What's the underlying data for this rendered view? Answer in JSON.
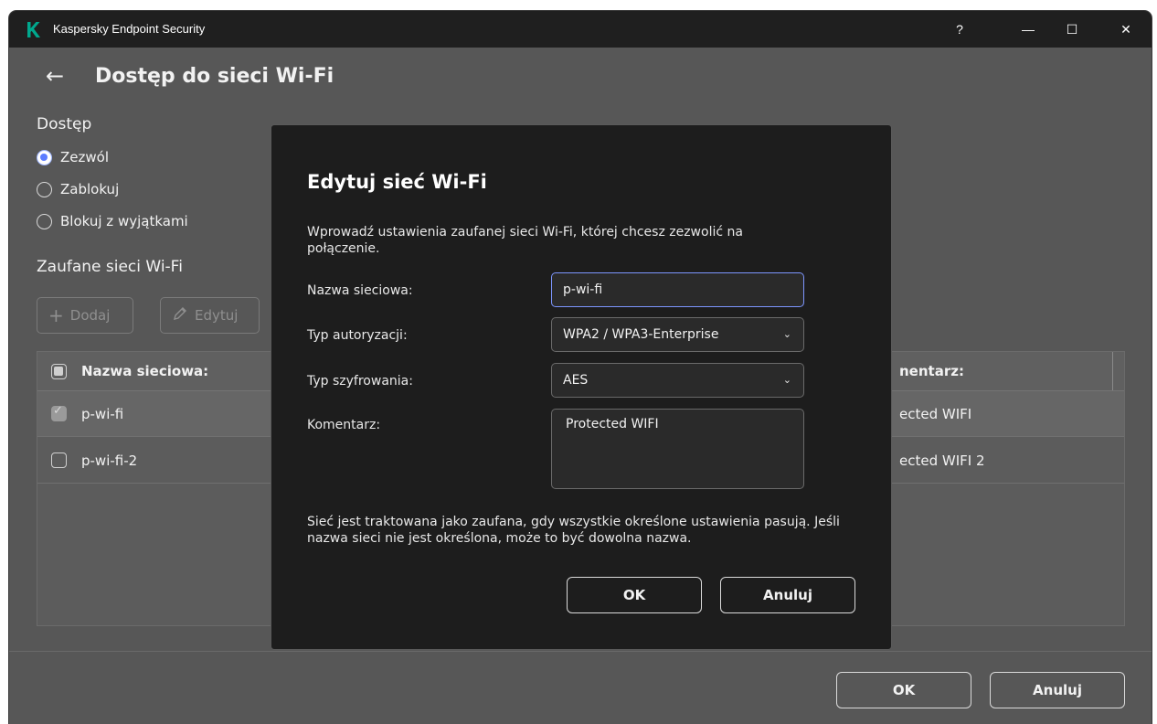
{
  "window": {
    "title": "Kaspersky Endpoint Security",
    "help_label": "?",
    "minimize_label": "—",
    "maximize_label": "☐",
    "close_label": "✕"
  },
  "page": {
    "back_label": "←",
    "title": "Dostęp do sieci Wi-Fi"
  },
  "access": {
    "heading": "Dostęp",
    "options": [
      {
        "label": "Zezwól",
        "selected": true
      },
      {
        "label": "Zablokuj",
        "selected": false
      },
      {
        "label": "Blokuj z wyjątkami",
        "selected": false
      }
    ]
  },
  "trusted": {
    "heading": "Zaufane sieci Wi-Fi",
    "add_label": "Dodaj",
    "edit_label": "Edytuj",
    "columns": {
      "name": "Nazwa sieciowa:",
      "comment": "nentarz:"
    },
    "rows": [
      {
        "name": "p-wi-fi",
        "comment": "ected WIFI",
        "checked": true
      },
      {
        "name": "p-wi-fi-2",
        "comment": "ected WIFI 2",
        "checked": false
      }
    ]
  },
  "footer": {
    "ok_label": "OK",
    "cancel_label": "Anuluj"
  },
  "dialog": {
    "title": "Edytuj sieć Wi-Fi",
    "description": "Wprowadź ustawienia zaufanej sieci Wi-Fi, której chcesz zezwolić na połączenie.",
    "network_name_label": "Nazwa sieciowa:",
    "network_name_value": "p-wi-fi",
    "auth_type_label": "Typ autoryzacji:",
    "auth_type_value": "WPA2 / WPA3-Enterprise",
    "encryption_label": "Typ szyfrowania:",
    "encryption_value": "AES",
    "comment_label": "Komentarz:",
    "comment_value": "Protected WIFI",
    "note": "Sieć jest traktowana jako zaufana, gdy wszystkie określone ustawienia pasują. Jeśli nazwa sieci nie jest określona, może to być dowolna nazwa.",
    "ok_label": "OK",
    "cancel_label": "Anuluj"
  },
  "colors": {
    "accent": "#5c7cff",
    "logo": "#00a88e",
    "titlebar": "#1f1f1f",
    "dialog_bg": "#1d1d1d"
  }
}
